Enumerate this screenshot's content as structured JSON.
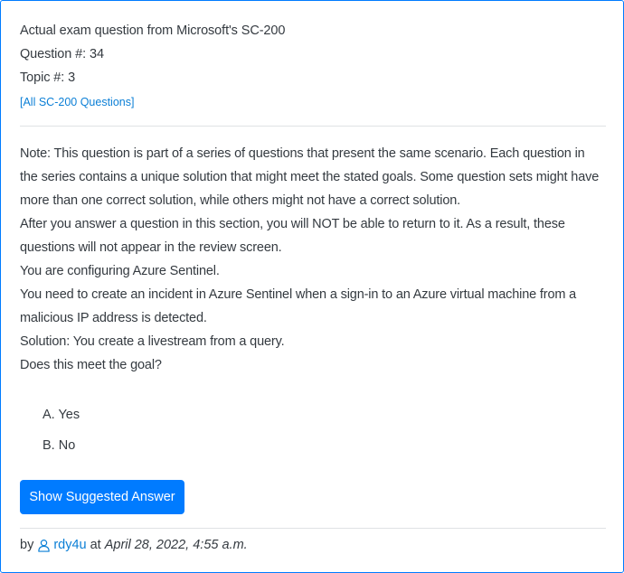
{
  "question_header": {
    "title": "Actual exam question from Microsoft's SC-200",
    "question_number": "Question #: 34",
    "topic": "Topic #: 3",
    "all_questions_link": "[All SC-200 Questions]"
  },
  "question_body": {
    "paragraphs": [
      "Note: This question is part of a series of questions that present the same scenario. Each question in the series contains a unique solution that might meet the stated goals. Some question sets might have more than one correct solution, while others might not have a correct solution.",
      "After you answer a question in this section, you will NOT be able to return to it. As a result, these questions will not appear in the review screen.",
      "You are configuring Azure Sentinel.",
      "You need to create an incident in Azure Sentinel when a sign-in to an Azure virtual machine from a malicious IP address is detected.",
      "Solution: You create a livestream from a query.",
      "Does this meet the goal?"
    ]
  },
  "choices": [
    "A. Yes",
    "B. No"
  ],
  "actions": {
    "show_answer_label": "Show Suggested Answer"
  },
  "footer": {
    "by_label": "by",
    "author": "rdy4u",
    "at_label": "at",
    "date": "April 28, 2022, 4:55 a.m.",
    "author_icon": "user-icon"
  },
  "colors": {
    "accent": "#007bff",
    "link": "#0b7fd6",
    "text": "#343a40",
    "divider": "#dfe2e5"
  }
}
